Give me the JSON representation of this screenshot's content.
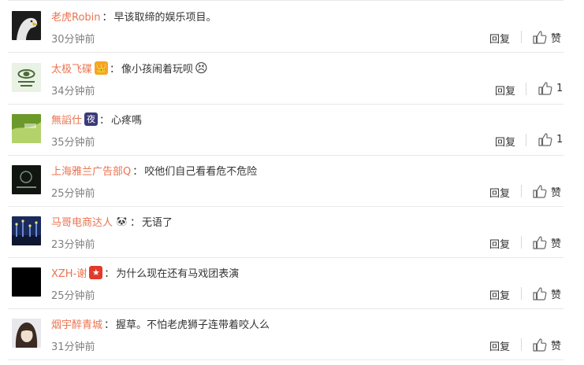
{
  "comments": [
    {
      "user": "老虎Robin",
      "badge": "",
      "badge_color": "",
      "text": "早该取缔的娱乐项目。",
      "emoji": "",
      "time": "30分钟前",
      "reply_label": "回复",
      "like_label": "赞",
      "avatar_icon": "eagle-avatar",
      "avatar_colors": [
        "#1c1c1c",
        "#e6e6e6"
      ]
    },
    {
      "user": "太极飞碟",
      "badge": "👑",
      "badge_color": "#f5a623",
      "text": "像小孩闹着玩呗",
      "emoji": "😣",
      "time": "34分钟前",
      "reply_label": "回复",
      "like_label": "1",
      "avatar_icon": "emblem-avatar",
      "avatar_colors": [
        "#e9f2e4",
        "#4a6b3a"
      ]
    },
    {
      "user": "無謟仕",
      "badge": "夜",
      "badge_color": "#3b3a7a",
      "text": "心疼嗎",
      "emoji": "",
      "time": "35分钟前",
      "reply_label": "回复",
      "like_label": "1",
      "avatar_icon": "green-leaf-avatar",
      "avatar_colors": [
        "#6c9a2a",
        "#c6e07a"
      ]
    },
    {
      "user": "上海雅兰广告部Q",
      "badge": "",
      "badge_color": "",
      "text": "咬他们自己看看危不危险",
      "emoji": "",
      "time": "25分钟前",
      "reply_label": "回复",
      "like_label": "赞",
      "avatar_icon": "dark-logo-avatar",
      "avatar_colors": [
        "#101510",
        "#7b8b7b"
      ]
    },
    {
      "user": "马哥电商达人",
      "badge": "🐼",
      "badge_color": "#ffffff",
      "text": "无语了",
      "emoji": "",
      "time": "23分钟前",
      "reply_label": "回复",
      "like_label": "赞",
      "avatar_icon": "city-lights-avatar",
      "avatar_colors": [
        "#1a2a5a",
        "#6a8ad0"
      ]
    },
    {
      "user": "XZH-谢",
      "badge": "★",
      "badge_color": "#e23a2a",
      "text": "为什么现在还有马戏团表演",
      "emoji": "",
      "time": "25分钟前",
      "reply_label": "回复",
      "like_label": "赞",
      "avatar_icon": "black-avatar",
      "avatar_colors": [
        "#000000",
        "#000000"
      ]
    },
    {
      "user": "烟宇醉青城",
      "badge": "",
      "badge_color": "",
      "text": "握草。不怕老虎狮子连带着咬人么",
      "emoji": "",
      "time": "31分钟前",
      "reply_label": "回复",
      "like_label": "赞",
      "avatar_icon": "portrait-avatar",
      "avatar_colors": [
        "#3a2a22",
        "#f0ded0"
      ]
    }
  ],
  "colon": "："
}
